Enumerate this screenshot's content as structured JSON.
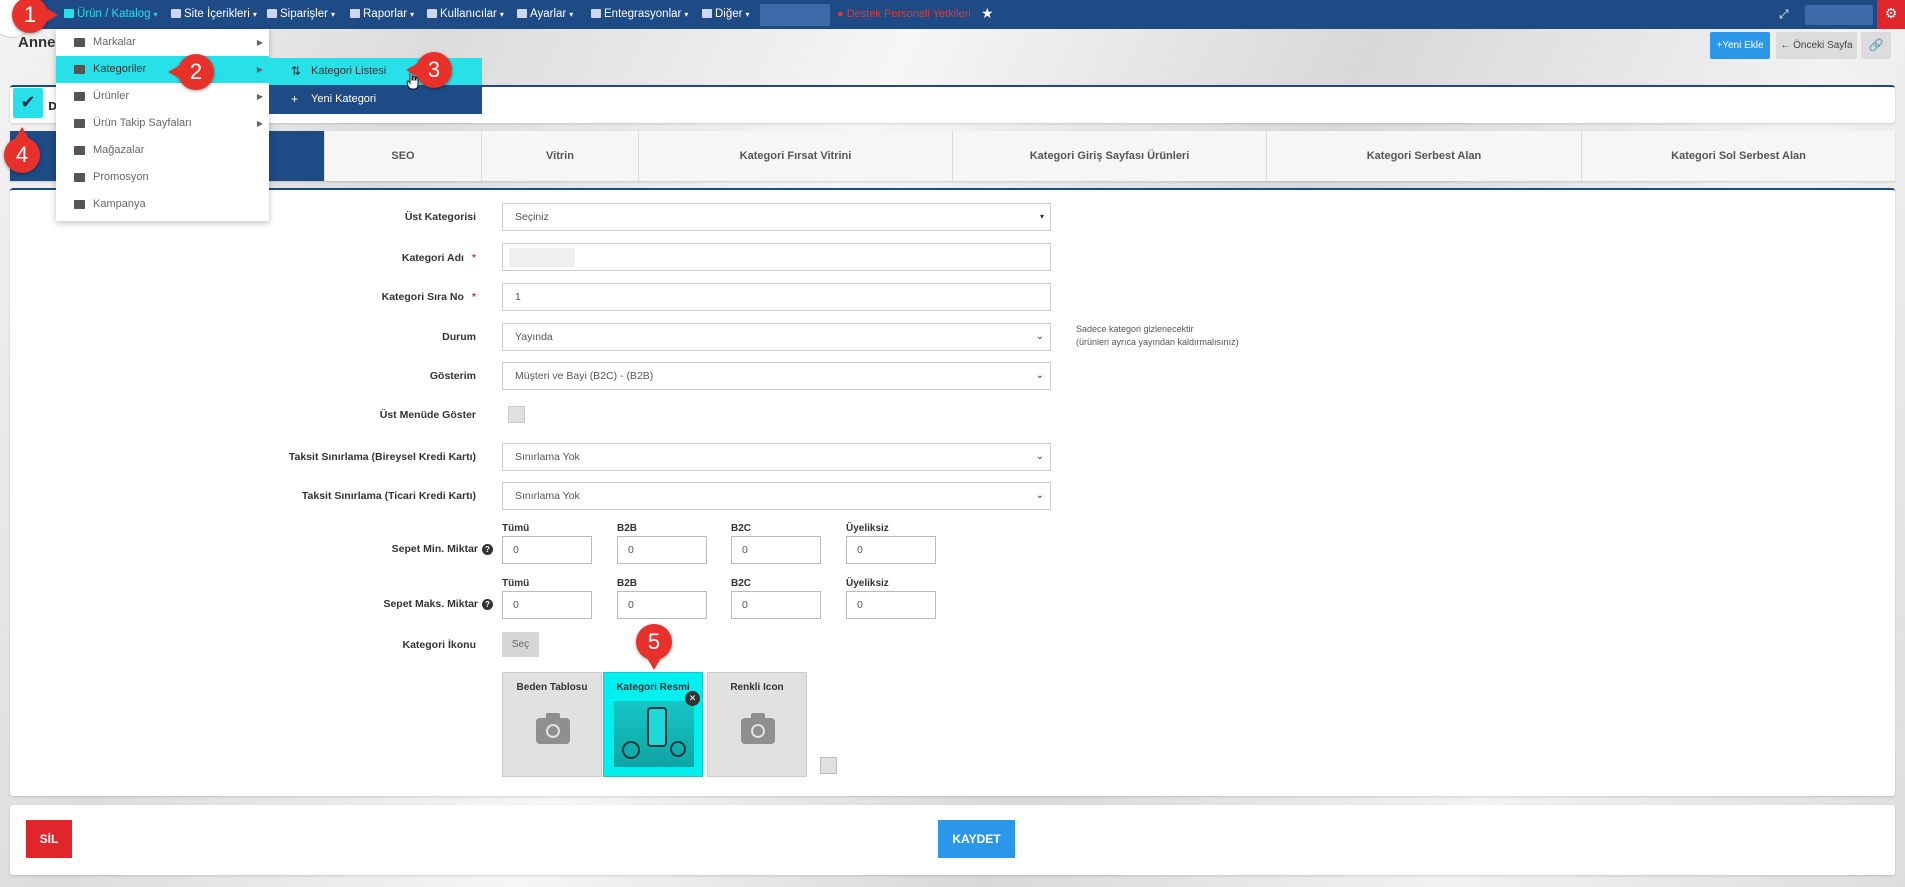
{
  "topbar": {
    "items": [
      {
        "label": "Ürün / Katalog",
        "icon": "boxes-icon"
      },
      {
        "label": "Site İçerikleri",
        "icon": "page-icon"
      },
      {
        "label": "Siparişler",
        "icon": "cart-icon"
      },
      {
        "label": "Raporlar",
        "icon": "report-icon"
      },
      {
        "label": "Kullanıcılar",
        "icon": "users-icon"
      },
      {
        "label": "Ayarlar",
        "icon": "gears-icon"
      },
      {
        "label": "Entegrasyonlar",
        "icon": "sitemap-icon"
      },
      {
        "label": "Diğer",
        "icon": "grid-icon"
      }
    ],
    "permission": "Destek Personeli Yetkileri",
    "star": "★",
    "expand": "⤢",
    "gear": "⚙",
    "accent": "#27e0e8",
    "bar_color": "#1e4a86"
  },
  "dropdown": {
    "items": [
      {
        "label": "Markalar",
        "icon": "card-icon"
      },
      {
        "label": "Kategoriler",
        "icon": "sort-icon"
      },
      {
        "label": "Ürünler",
        "icon": "cubes-icon"
      },
      {
        "label": "Ürün Takip Sayfaları",
        "icon": "calendar-check-icon"
      },
      {
        "label": "Mağazalar",
        "icon": "store-icon"
      },
      {
        "label": "Promosyon",
        "icon": "gift-icon"
      },
      {
        "label": "Kampanya",
        "icon": "tags-icon"
      }
    ],
    "arrow": "▶"
  },
  "submenu": {
    "items": [
      {
        "label": "Kategori Listesi",
        "icon": "sort-icon",
        "glyph": "⇅"
      },
      {
        "label": "Yeni Kategori",
        "icon": "plus-icon",
        "glyph": "+"
      }
    ]
  },
  "badges": [
    "1",
    "2",
    "3",
    "4",
    "5"
  ],
  "header": {
    "title": "Anne-",
    "add_label": "+Yeni Ekle",
    "back_label": "← Önceki Sayfa",
    "link_icon": "🔗"
  },
  "status": {
    "check": "✔",
    "letter": "D"
  },
  "tabs": [
    "SEO",
    "Vitrin",
    "Kategori Fırsat Vitrini",
    "Kategori Giriş Sayfası Ürünleri",
    "Kategori Serbest Alan",
    "Kategori Sol Serbest Alan"
  ],
  "form": {
    "parent_label": "Üst Kategorisi",
    "parent_value": "Seçiniz",
    "name_label": "Kategori Adı",
    "order_label": "Kategori Sıra No",
    "order_value": "1",
    "required": "*",
    "status_label": "Durum",
    "status_value": "Yayında",
    "status_hint_1": "Sadece kategori gizlenecektir",
    "status_hint_2": "(ürünleri ayrıca yayından kaldırmalısınız)",
    "display_label": "Gösterim",
    "display_value": "Müşteri ve Bayi (B2C) - (B2B)",
    "top_menu_label": "Üst Menüde Göster",
    "inst_personal_label": "Taksit Sınırlama (Bireysel Kredi Kartı)",
    "inst_personal_value": "Sınırlama Yok",
    "inst_business_label": "Taksit Sınırlama (Ticari Kredi Kartı)",
    "inst_business_value": "Sınırlama Yok",
    "cart_min_label": "Sepet Min. Miktar",
    "cart_max_label": "Sepet Maks. Miktar",
    "help": "?",
    "qty_cols": [
      "Tümü",
      "B2B",
      "B2C",
      "Üyeliksiz"
    ],
    "min_values": [
      "0",
      "0",
      "0",
      "0"
    ],
    "max_values": [
      "0",
      "0",
      "0",
      "0"
    ],
    "icon_label": "Kategori İkonu",
    "select_label": "Seç",
    "images": [
      "Beden Tablosu",
      "Kategori Resmi",
      "Renkli Icon"
    ],
    "remove": "✕",
    "chevron": "⌄",
    "caret": "▾"
  },
  "footer": {
    "delete_label": "SİL",
    "save_label": "KAYDET"
  }
}
